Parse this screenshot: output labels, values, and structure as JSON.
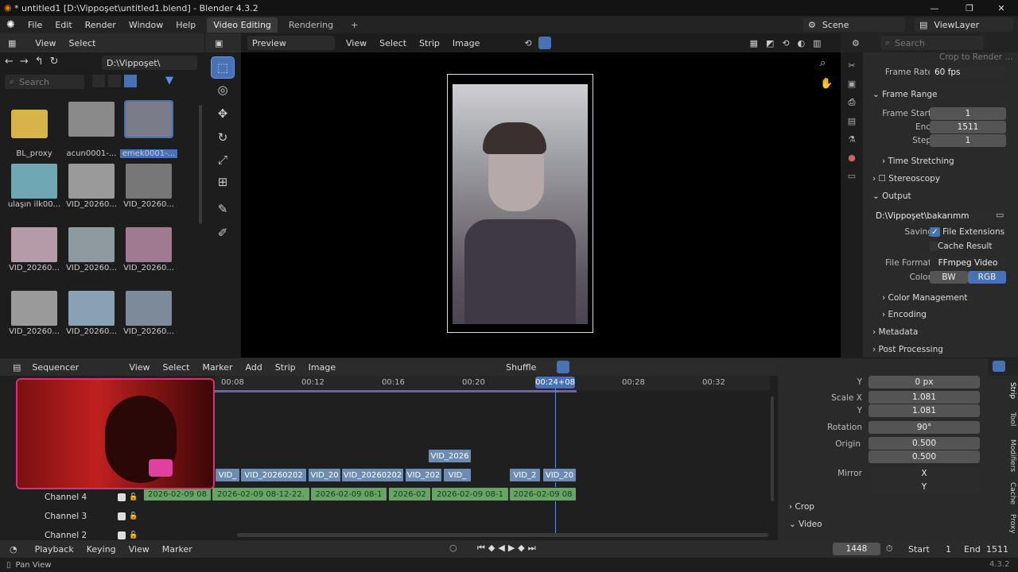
{
  "window": {
    "title": "* untitled1 [D:\\Vippoşet\\untitled1.blend] - Blender 4.3.2",
    "minimize": "—",
    "maximize": "❐",
    "close": "✕"
  },
  "menubar": {
    "items": [
      "File",
      "Edit",
      "Render",
      "Window",
      "Help"
    ],
    "workspaces": [
      "Video Editing",
      "Rendering"
    ],
    "add_ws": "+",
    "scene": "Scene",
    "viewlayer": "ViewLayer"
  },
  "filebrowser": {
    "menus": [
      "View",
      "Select"
    ],
    "path": "D:\\Vippoşet\\",
    "search_placeholder": "Search",
    "items": [
      {
        "label": "BL_proxy",
        "color": "#d8b34a"
      },
      {
        "label": "acun0001-...",
        "color": "#8a8a8a"
      },
      {
        "label": "emek0001-...",
        "color": "#7a7c8a"
      },
      {
        "label": "ulaşın ilk00...",
        "color": "#6fa7b5"
      },
      {
        "label": "VID_20260...",
        "color": "#9a9a9a"
      },
      {
        "label": "VID_20260...",
        "color": "#777"
      },
      {
        "label": "VID_20260...",
        "color": "#b59aa8"
      },
      {
        "label": "VID_20260...",
        "color": "#8e9aa0"
      },
      {
        "label": "VID_20260...",
        "color": "#a07a90"
      },
      {
        "label": "VID_20260...",
        "color": "#9a9a9a"
      },
      {
        "label": "VID_20260...",
        "color": "#8aa0b5"
      },
      {
        "label": "VID_20260...",
        "color": "#7c8a9a"
      }
    ]
  },
  "preview": {
    "mode": "Preview",
    "menus": [
      "View",
      "Select",
      "Strip",
      "Image"
    ]
  },
  "properties": {
    "search_placeholder": "Search",
    "crop_to_render": "Crop to Render ...",
    "frame_rate_label": "Frame Rate",
    "frame_rate": "60 fps",
    "frame_range": "Frame Range",
    "frame_start_label": "Frame Start",
    "frame_start": "1",
    "end_label": "End",
    "end": "1511",
    "step_label": "Step",
    "step": "1",
    "time_stretching": "Time Stretching",
    "stereoscopy": "Stereoscopy",
    "output": "Output",
    "output_path": "D:\\Vippoşet\\bakarımm",
    "saving_label": "Saving",
    "file_ext": "File Extensions",
    "cache_result": "Cache Result",
    "file_format_label": "File Format",
    "file_format": "FFmpeg Video",
    "color_label": "Color",
    "bw": "BW",
    "rgb": "RGB",
    "color_management": "Color Management",
    "encoding": "Encoding",
    "metadata": "Metadata",
    "post_processing": "Post Processing"
  },
  "sequencer": {
    "mode": "Sequencer",
    "menus": [
      "View",
      "Select",
      "Marker",
      "Add",
      "Strip",
      "Image"
    ],
    "shuffle": "Shuffle",
    "ticks": [
      "00:08",
      "00:12",
      "00:16",
      "00:20",
      "00:28",
      "00:32"
    ],
    "current": "00:24+08",
    "channels": [
      "Channel 4",
      "Channel 3",
      "Channel 2"
    ],
    "strips_top": [
      {
        "label": "VID_2026"
      }
    ],
    "strips_mid": [
      {
        "label": "VID_"
      },
      {
        "label": "VID_20260202"
      },
      {
        "label": "VID_20"
      },
      {
        "label": "VID_20260202"
      },
      {
        "label": "VID_202"
      },
      {
        "label": "VID_"
      },
      {
        "label": "VID_2"
      },
      {
        "label": "VID_20"
      }
    ],
    "strips_low": [
      {
        "label": "2026-02-09 08"
      },
      {
        "label": "2026-02-09 08-12-22."
      },
      {
        "label": "2026-02-09 08-1"
      },
      {
        "label": "2026-02"
      },
      {
        "label": "2026-02-09 08-1"
      },
      {
        "label": "2026-02-09 08"
      }
    ]
  },
  "strip_props": {
    "y_label": "Y",
    "y_val": "0 px",
    "scale_x_label": "Scale X",
    "scale_x": "1.081",
    "scale_y_label": "Y",
    "scale_y": "1.081",
    "rotation_label": "Rotation",
    "rotation": "90°",
    "origin_label": "Origin",
    "origin_x": "0.500",
    "origin_y": "0.500",
    "mirror_label": "Mirror",
    "mirror_x": "X",
    "mirror_y": "Y",
    "crop": "Crop",
    "video": "Video",
    "tabs": [
      "Strip",
      "Tool",
      "Modifiers",
      "Cache",
      "Proxy"
    ]
  },
  "timeline": {
    "menus": [
      "Playback",
      "Keying",
      "View",
      "Marker"
    ],
    "frame": "1448",
    "start_label": "Start",
    "start": "1",
    "end_label": "End",
    "end": "1511"
  },
  "status": {
    "left": "Pan View",
    "version": "4.3.2"
  }
}
